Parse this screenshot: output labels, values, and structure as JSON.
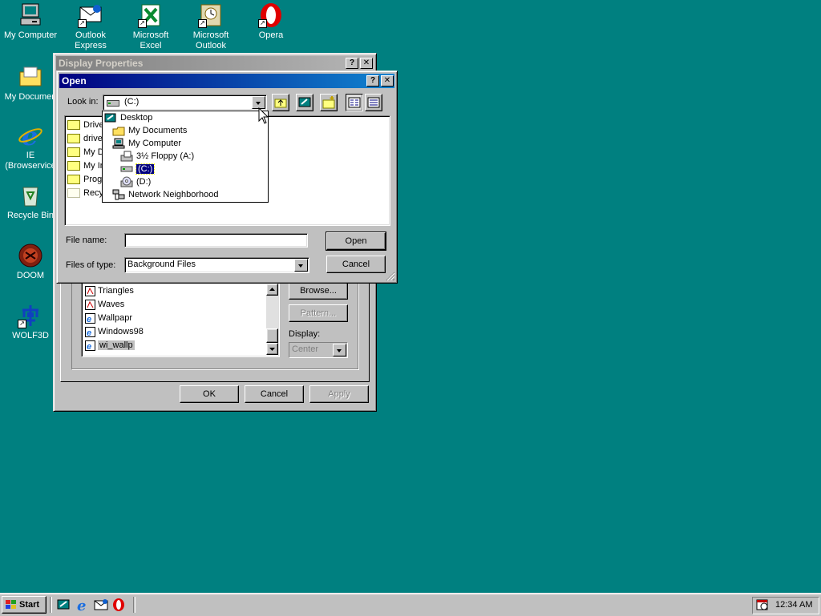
{
  "desktop": {
    "icons": [
      {
        "label": "My Computer",
        "icon": "my-computer-icon"
      },
      {
        "label": "Outlook\nExpress",
        "icon": "outlook-express-icon"
      },
      {
        "label": "Microsoft\nExcel",
        "icon": "excel-icon"
      },
      {
        "label": "Microsoft\nOutlook",
        "icon": "outlook-icon"
      },
      {
        "label": "Opera",
        "icon": "opera-icon"
      },
      {
        "label": "My Documen",
        "icon": "my-documents-icon"
      },
      {
        "label": "IE\n(Browservice",
        "icon": "ie-icon"
      },
      {
        "label": "Recycle Bin",
        "icon": "recycle-bin-icon"
      },
      {
        "label": "DOOM",
        "icon": "doom-icon"
      },
      {
        "label": "WOLF3D",
        "icon": "wolf3d-icon"
      }
    ]
  },
  "display_properties": {
    "title": "Display Properties",
    "wallpapers": [
      "Triangles",
      "Waves",
      "Wallpapr",
      "Windows98",
      "wi_wallp"
    ],
    "browse_label": "Browse...",
    "pattern_label": "Pattern...",
    "display_label": "Display:",
    "display_value": "Center",
    "ok_label": "OK",
    "cancel_label": "Cancel",
    "apply_label": "Apply"
  },
  "open_dialog": {
    "title": "Open",
    "look_in_label": "Look in:",
    "look_in_value": "(C:)",
    "files": [
      "Driver",
      "driver",
      "My Do",
      "My Ins",
      "Progra",
      "Recyc"
    ],
    "file_name_label": "File name:",
    "file_name_value": "",
    "files_of_type_label": "Files of type:",
    "files_of_type_value": "Background Files",
    "open_label": "Open",
    "cancel_label": "Cancel",
    "dropdown": [
      "Desktop",
      "My Documents",
      "My Computer",
      "3½ Floppy (A:)",
      "(C:)",
      "(D:)",
      "Network Neighborhood"
    ]
  },
  "taskbar": {
    "start_label": "Start",
    "clock": "12:34 AM"
  },
  "colors": {
    "desktop": "#008080",
    "title_active": "#000080",
    "face": "#c0c0c0"
  }
}
